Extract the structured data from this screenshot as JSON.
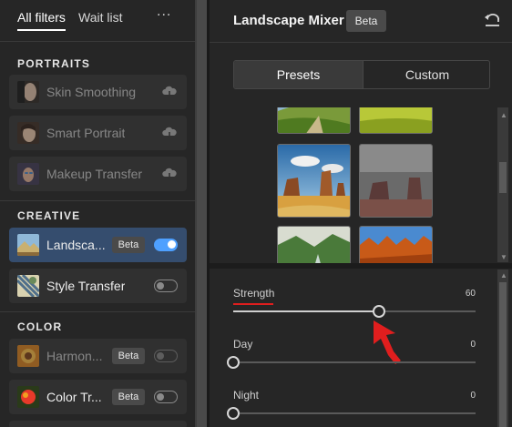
{
  "left_panel": {
    "tabs": [
      {
        "label": "All filters",
        "active": true
      },
      {
        "label": "Wait list",
        "active": false
      }
    ],
    "more_label": "...",
    "sections": [
      {
        "title": "PORTRAITS"
      },
      {
        "title": "CREATIVE"
      },
      {
        "title": "COLOR"
      }
    ],
    "items": [
      {
        "label": "Skin Smoothing",
        "state": "download",
        "icon": "cloud-download-icon"
      },
      {
        "label": "Smart Portrait",
        "state": "download",
        "icon": "cloud-download-icon"
      },
      {
        "label": "Makeup Transfer",
        "state": "download",
        "icon": "cloud-download-icon"
      },
      {
        "label": "Landscape Mixer",
        "display": "Landsca...",
        "badge": "Beta",
        "enabled": true
      },
      {
        "label": "Style Transfer",
        "enabled": false
      },
      {
        "label": "Harmonization",
        "display": "Harmon...",
        "badge": "Beta",
        "enabled": false
      },
      {
        "label": "Color Transfer",
        "display": "Color Tr...",
        "badge": "Beta",
        "enabled": false
      }
    ]
  },
  "right_panel": {
    "title": "Landscape Mixer",
    "badge": "Beta",
    "undo_icon": "reset-icon",
    "segments": [
      {
        "label": "Presets",
        "active": true
      },
      {
        "label": "Custom",
        "active": false
      }
    ],
    "presets": [
      {
        "name": "green-hills"
      },
      {
        "name": "yellow-field"
      },
      {
        "name": "desert-monuments"
      },
      {
        "name": "grey-mesa"
      },
      {
        "name": "green-valley-river"
      },
      {
        "name": "autumn-forest"
      }
    ],
    "sliders": [
      {
        "label": "Strength",
        "value": 60,
        "value_text": "60"
      },
      {
        "label": "Day",
        "value": 0,
        "value_text": "0"
      },
      {
        "label": "Night",
        "value": 0,
        "value_text": "0"
      }
    ]
  },
  "colors": {
    "accent": "#4ea0ff",
    "active_item_bg": "#354d6e",
    "annotation_red": "#e01e1e"
  }
}
